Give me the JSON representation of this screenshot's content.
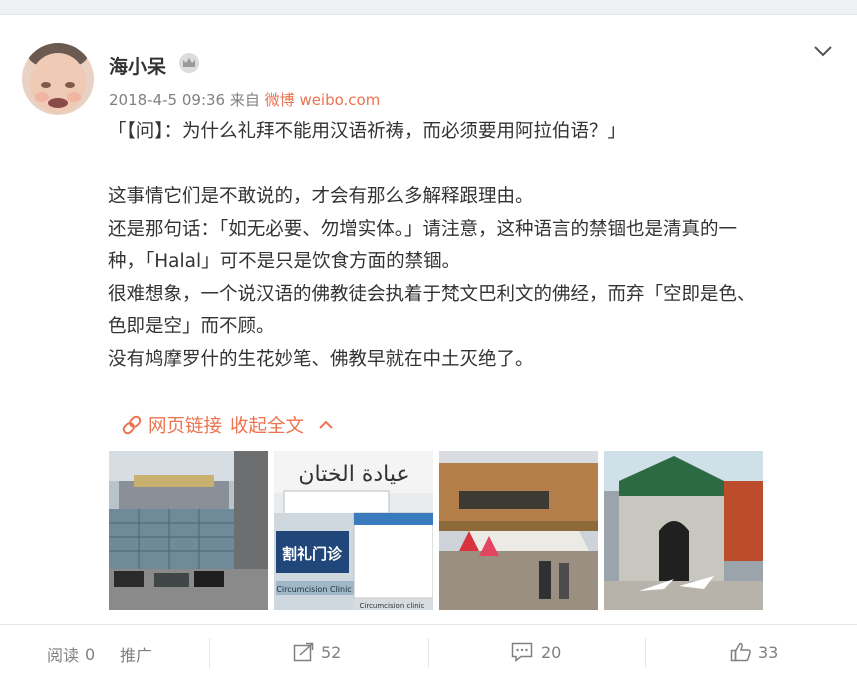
{
  "post": {
    "username": "海小呆",
    "timestamp": "2018-4-5 09:36",
    "from_prefix": "来自",
    "source": "微博 weibo.com",
    "paragraphs": [
      "「【问】：为什么礼拜不能用汉语祈祷，而必须要用阿拉伯语？」",
      "",
      "这事情它们是不敢说的，才会有那么多解释跟理由。",
      "还是那句话：「如无必要、勿增实体。」请注意，这种语言的禁锢也是清真的一",
      "种，「Halal」可不是只是饮食方面的禁锢。",
      "很难想象，一个说汉语的佛教徒会执着于梵文巴利文的佛经，而弃「空即是色、",
      "色即是空」而不顾。",
      "没有鸠摩罗什的生花妙笔、佛教早就在中土灭绝了。"
    ],
    "web_link_label": "网页链接",
    "collapse_label": "收起全文",
    "images": [
      {
        "caption": ""
      },
      {
        "arabic_sign": "عيادة الختان",
        "sign_cn": "割礼门诊",
        "clinic_en": "Circumcision Clinic",
        "clinic_en_small": "Circumcision clinic"
      },
      {
        "caption": ""
      },
      {
        "caption": ""
      }
    ]
  },
  "actions": {
    "read_label": "阅读",
    "read_count": "0",
    "promote_label": "推广",
    "forward_count": "52",
    "comment_count": "20",
    "like_count": "33"
  },
  "colors": {
    "accent": "#eb7350",
    "text": "#333333",
    "muted": "#808080",
    "divider": "#e6e6e6"
  },
  "icons": [
    "crown-badge-icon",
    "chevron-down-icon",
    "link-icon",
    "chevron-up-icon",
    "forward-icon",
    "comment-icon",
    "like-icon"
  ]
}
